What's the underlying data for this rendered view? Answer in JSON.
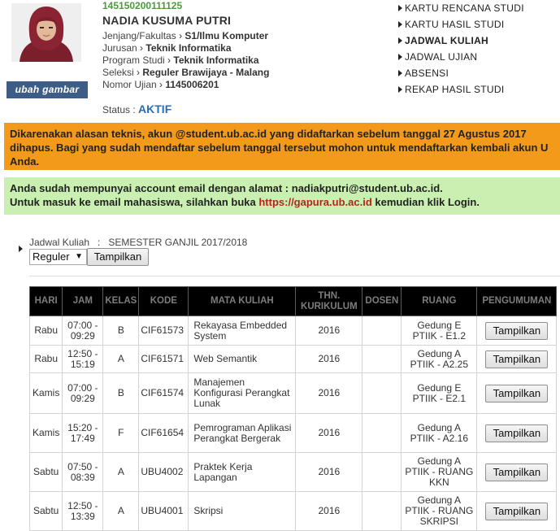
{
  "profile": {
    "nim": "145150200111125",
    "nama": "NADIA KUSUMA PUTRI",
    "ubah_gambar": "ubah gambar",
    "details": [
      {
        "label": "Jenjang/Fakultas",
        "value": "S1/Ilmu Komputer"
      },
      {
        "label": "Jurusan",
        "value": "Teknik Informatika"
      },
      {
        "label": "Program Studi",
        "value": "Teknik Informatika"
      },
      {
        "label": "Seleksi",
        "value": "Reguler Brawijaya - Malang"
      },
      {
        "label": "Nomor Ujian",
        "value": "1145006201"
      }
    ],
    "status_label": "Status :",
    "status_value": "AKTIF"
  },
  "menu": [
    {
      "label": "KARTU RENCANA STUDI",
      "active": false
    },
    {
      "label": "KARTU HASIL STUDI",
      "active": false
    },
    {
      "label": "JADWAL KULIAH",
      "active": true
    },
    {
      "label": "JADWAL UJIAN",
      "active": false
    },
    {
      "label": "ABSENSI",
      "active": false
    },
    {
      "label": "REKAP HASIL STUDI",
      "active": false
    }
  ],
  "notices": {
    "orange_lines": [
      "Dikarenakan alasan teknis, akun @student.ub.ac.id yang didaftarkan sebelum tanggal 27 Agustus 2017",
      "dihapus. Bagi yang sudah mendaftar sebelum tanggal tersebut mohon untuk mendaftarkan kembali akun U",
      "Anda."
    ],
    "green_line1": "Anda sudah mempunyai account email dengan alamat : nadiakputri@student.ub.ac.id.",
    "green_line2_pre": "Untuk masuk ke email mahasiswa, silahkan buka ",
    "green_link": "https://gapura.ub.ac.id",
    "green_line2_post": " kemudian klik Login."
  },
  "filter": {
    "label": "Jadwal Kuliah   :   SEMESTER GANJIL 2017/2018",
    "select_value": "Reguler",
    "button": "Tampilkan"
  },
  "table": {
    "headers": [
      "HARI",
      "JAM",
      "KELAS",
      "KODE",
      "MATA KULIAH",
      "THN. KURIKULUM",
      "DOSEN",
      "RUANG",
      "PENGUMUMAN"
    ],
    "button_label": "Tampilkan",
    "rows": [
      {
        "hari": "Rabu",
        "jam": "07:00 - 09:29",
        "kelas": "B",
        "kode": "CIF61573",
        "mk": "Rekayasa Embedded System",
        "thn": "2016",
        "dosen": "",
        "ruang": "Gedung E PTIIK - E1.2"
      },
      {
        "hari": "Rabu",
        "jam": "12:50 - 15:19",
        "kelas": "A",
        "kode": "CIF61571",
        "mk": "Web Semantik",
        "thn": "2016",
        "dosen": "",
        "ruang": "Gedung A PTIIK - A2.25"
      },
      {
        "hari": "Kamis",
        "jam": "07:00 - 09:29",
        "kelas": "B",
        "kode": "CIF61574",
        "mk": "Manajemen Konfigurasi Perangkat Lunak",
        "thn": "2016",
        "dosen": "",
        "ruang": "Gedung E PTIIK - E2.1"
      },
      {
        "hari": "Kamis",
        "jam": "15:20 - 17:49",
        "kelas": "F",
        "kode": "CIF61654",
        "mk": "Pemrograman Aplikasi Perangkat Bergerak",
        "thn": "2016",
        "dosen": "",
        "ruang": "Gedung A PTIIK - A2.16"
      },
      {
        "hari": "Sabtu",
        "jam": "07:50 - 08:39",
        "kelas": "A",
        "kode": "UBU4002",
        "mk": "Praktek Kerja Lapangan",
        "thn": "2016",
        "dosen": "",
        "ruang": "Gedung A PTIIK - RUANG KKN"
      },
      {
        "hari": "Sabtu",
        "jam": "12:50 - 13:39",
        "kelas": "A",
        "kode": "UBU4001",
        "mk": "Skripsi",
        "thn": "2016",
        "dosen": "",
        "ruang": "Gedung A PTIIK - RUANG SKRIPSI"
      }
    ]
  },
  "colors": {
    "nim": "#4a9a3b",
    "status": "#2a6db6",
    "orange_notice": "#f39a1b",
    "green_notice": "#c9f0b0",
    "link": "#b3261e",
    "ubah_button": "#3d5d86"
  }
}
